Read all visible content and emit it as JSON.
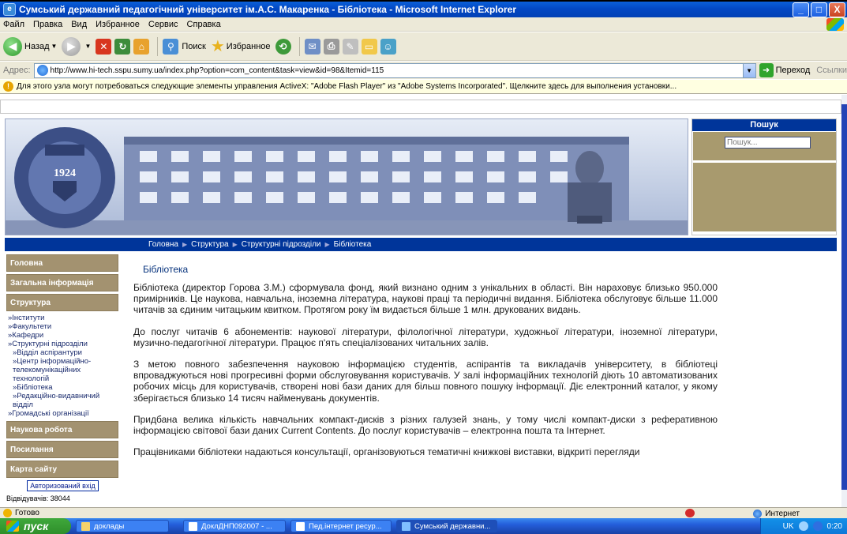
{
  "window": {
    "title": "Сумський державний педагогічний університет ім.А.С. Макаренка - Бібліотека - Microsoft Internet Explorer",
    "controls": [
      "_",
      "□",
      "X"
    ]
  },
  "menu": [
    "Файл",
    "Правка",
    "Вид",
    "Избранное",
    "Сервис",
    "Справка"
  ],
  "toolbar": {
    "back_label": "Назад",
    "search_label": "Поиск",
    "favorites_label": "Избранное"
  },
  "address": {
    "label": "Адрес:",
    "url": "http://www.hi-tech.sspu.sumy.ua/index.php?option=com_content&task=view&id=98&Itemid=115",
    "go_label": "Переход",
    "links_label": "Ссылки"
  },
  "infobar": {
    "text": "Для этого узла могут потребоваться следующие элементы управления ActiveX: \"Adobe Flash Player\" из \"Adobe Systems Incorporated\". Щелкните здесь для выполнения установки..."
  },
  "header_banner": {
    "seal_year": "1924"
  },
  "search": {
    "title": "Пошук",
    "placeholder": "Пошук..."
  },
  "breadcrumbs": [
    "Головна",
    "Структура",
    "Структурні підрозділи",
    "Бібліотека"
  ],
  "sidebar": {
    "items": [
      {
        "label": "Головна"
      },
      {
        "label": "Загальна інформація"
      },
      {
        "label": "Структура"
      },
      {
        "label": "Наукова робота"
      },
      {
        "label": "Посилання"
      },
      {
        "label": "Карта сайту"
      }
    ],
    "structure_links": [
      "»Інститути",
      "»Факультети",
      "»Кафедри",
      "»Структурні підрозділи",
      "»Відділ аспірантури",
      "»Центр інформаційно-телекомунікаційних технологій",
      "»Бібліотека",
      "»Редакційно-видавничий відділ",
      "»Громадські організації"
    ],
    "login_label": "Авторизований вхід",
    "visitors": "Відвідувачів: 38044"
  },
  "content": {
    "title": "Бібліотека",
    "paragraphs": [
      "Бібліотека (директор Горова З.М.) сформувала фонд, який визнано одним з унікальних в області. Він нараховує близько 950.000 примірників. Це наукова, навчальна, іноземна література, наукові праці та періодичні видання. Бібліотека обслуговує більше 11.000 читачів за єдиним читацьким квитком. Протягом року їм видається більше 1 млн. друкованих видань.",
      "До послуг читачів 6 абонементів: наукової літератури, філологічної літератури, художньої літератури, іноземної літератури, музично-педагогічної літератури. Працює п'ять спеціалізованих читальних залів.",
      "З метою повного забезпечення науковою інформацією студентів, аспірантів та викладачів університету, в бібліотеці впроваджуються нові прогресивні форми обслуговування користувачів. У залі інформаційних технологій діють 10 автоматизованих робочих місць для користувачів, створені нові бази даних для більш повного пошуку інформації. Діє електронний каталог, у якому зберігається близько 14 тисяч найменувань документів.",
      "Придбана велика кількість навчальних компакт-дисків з різних галузей знань, у тому числі компакт-диски з реферативною інформацією світової бази даних Current Contents. До послуг користувачів – електронна пошта та Інтернет.",
      "Працівниками бібліотеки надаються консультації, організовуються тематичні книжкові виставки, відкриті перегляди"
    ]
  },
  "status": {
    "left": "Готово",
    "zone": "Интернет"
  },
  "taskbar": {
    "start_label": "пуск",
    "tasks": [
      "доклады",
      "ДоклДНП092007 - ...",
      "Пед.інтернет ресур...",
      "Сумський державни..."
    ],
    "lang": "UK",
    "clock": "0:20"
  },
  "colors": {
    "accent_blue": "#00359a",
    "menu_gold": "#a39270"
  }
}
